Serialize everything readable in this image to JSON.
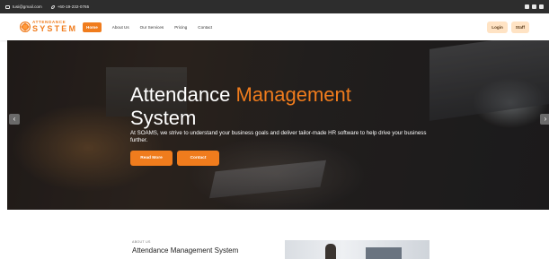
{
  "topbar": {
    "email": "tusi@gmail.com",
    "phone": "+60-19-232-0765",
    "email_icon": "mail-icon",
    "phone_icon": "phone-icon",
    "social_icons": [
      "facebook-icon",
      "instagram-icon",
      "linkedin-icon"
    ]
  },
  "brand": {
    "name_top": "ATTENDANCE",
    "name_bottom": "SYSTEM",
    "color": "#f07c1d"
  },
  "nav": {
    "items": [
      {
        "label": "Home",
        "active": true
      },
      {
        "label": "About Us",
        "active": false
      },
      {
        "label": "Our Services",
        "active": false
      },
      {
        "label": "Pricing",
        "active": false
      },
      {
        "label": "Contact",
        "active": false
      }
    ],
    "login_label": "Login",
    "staff_label": "Staff"
  },
  "hero": {
    "title_part1": "Attendance",
    "title_accent": "Management",
    "title_part2": "System",
    "description": "At SOAMS, we strive to understand your business goals and deliver tailor-made HR software to help drive your business further.",
    "primary_button": "Read More",
    "secondary_button": "Contact",
    "prev_arrow": "‹",
    "next_arrow": "›"
  },
  "about": {
    "eyebrow": "ABOUT US",
    "title": "Attendance Management System"
  },
  "colors": {
    "accent": "#f07c1d",
    "topbar_bg": "#2d2d2d",
    "pill_bg": "#ffe3c4"
  }
}
